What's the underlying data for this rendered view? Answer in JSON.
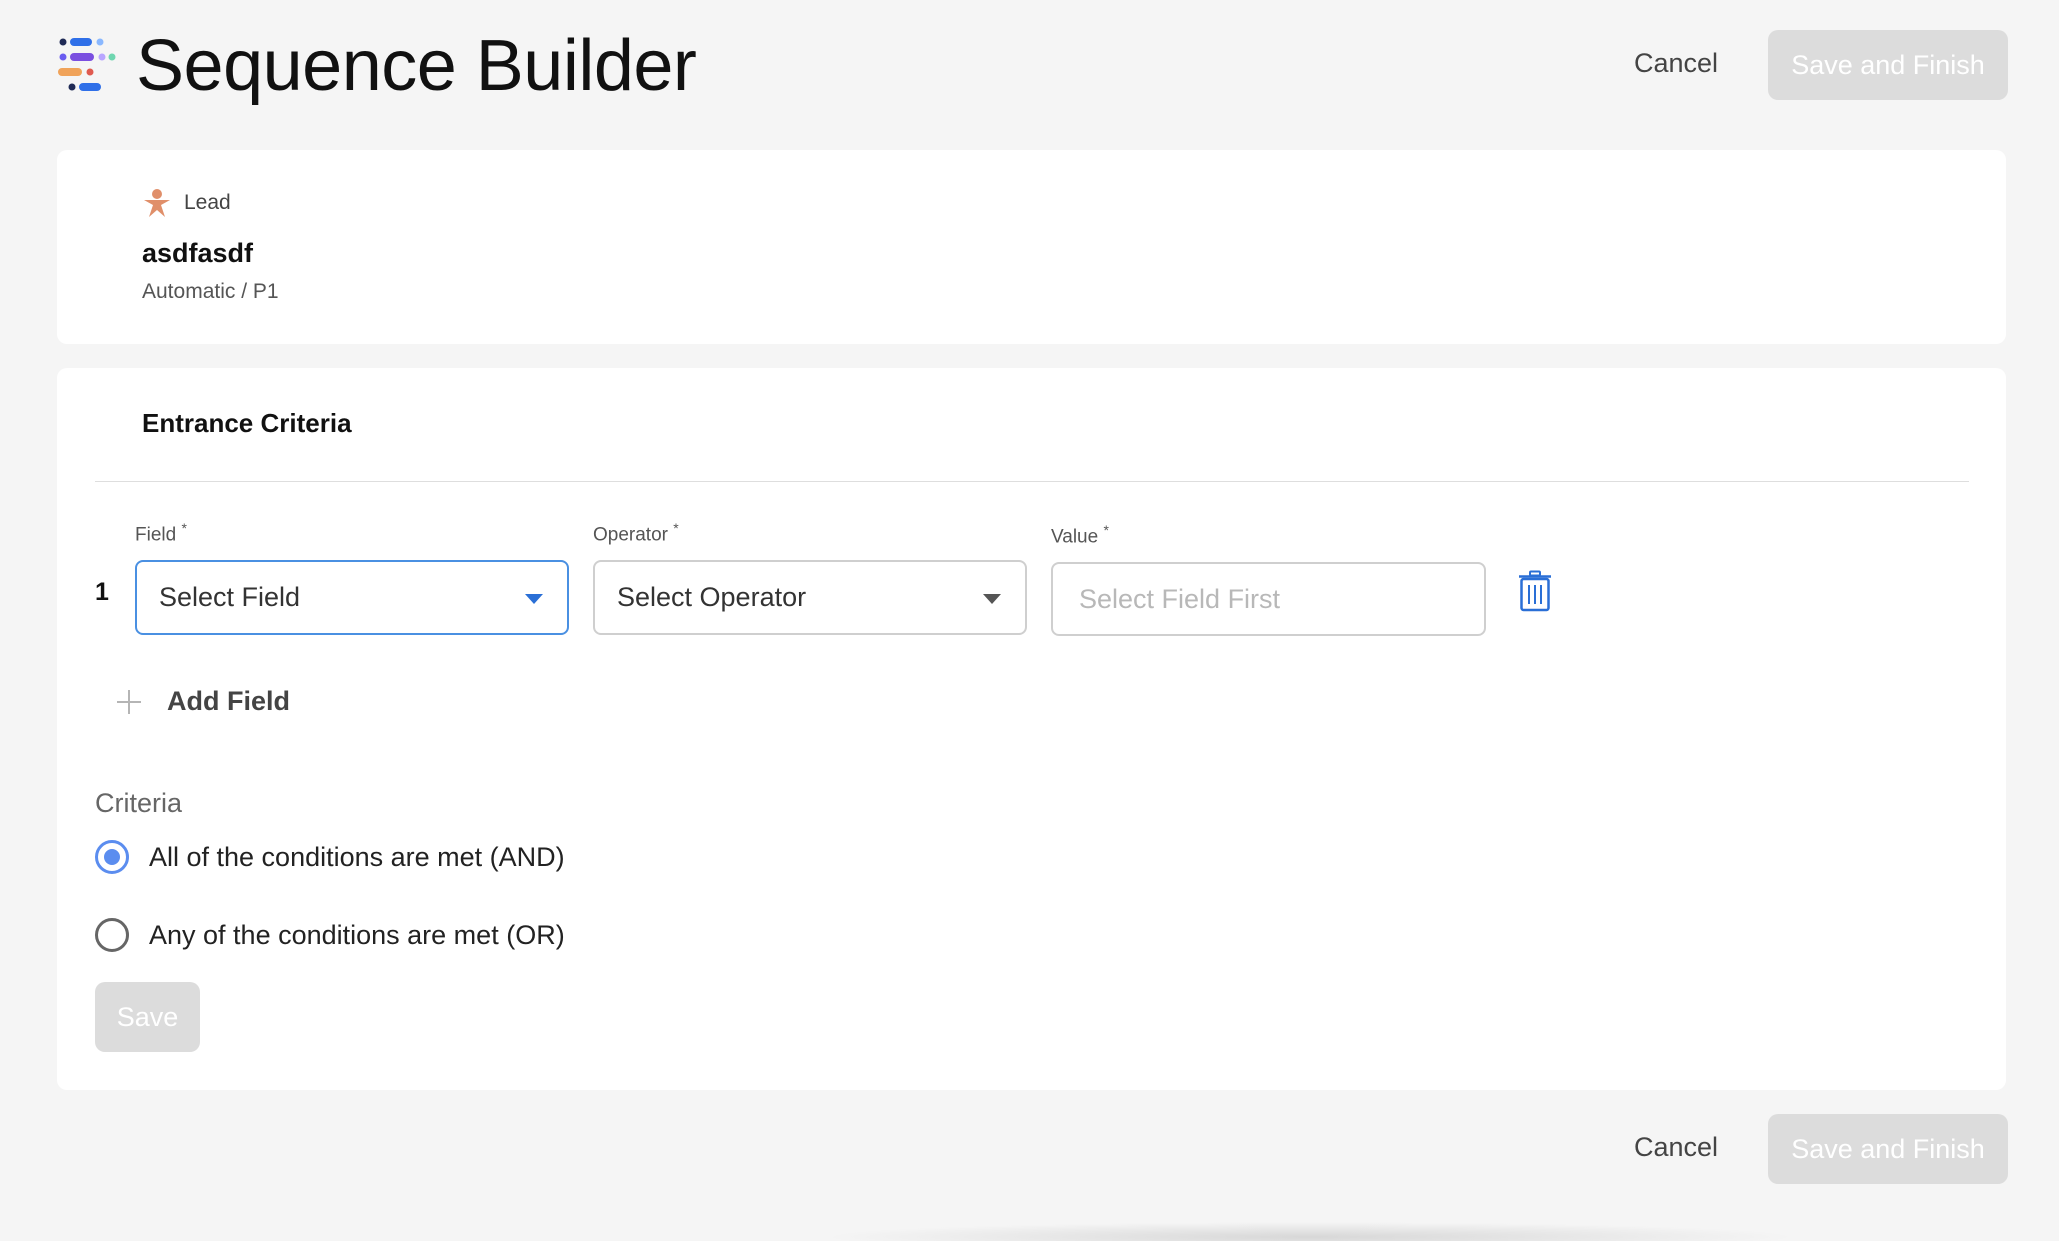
{
  "header": {
    "title": "Sequence Builder",
    "cancel_label": "Cancel",
    "save_finish_label": "Save and Finish"
  },
  "lead": {
    "tag": "Lead",
    "name": "asdfasdf",
    "sub": "Automatic / P1"
  },
  "criteria": {
    "section_title": "Entrance Criteria",
    "labels": {
      "field": "Field",
      "operator": "Operator",
      "value": "Value",
      "required_mark": "*"
    },
    "rows": [
      {
        "number": "1",
        "field_value": "Select Field",
        "operator_value": "Select Operator",
        "value_placeholder": "Select Field First"
      }
    ],
    "add_field_label": "Add Field",
    "criteria_label": "Criteria",
    "options": [
      {
        "label": "All of the conditions are met (AND)",
        "checked": true
      },
      {
        "label": "Any of the conditions are met (OR)",
        "checked": false
      }
    ],
    "save_label": "Save"
  },
  "footer": {
    "cancel_label": "Cancel",
    "save_finish_label": "Save and Finish"
  },
  "colors": {
    "accent": "#4a90e2",
    "radio_checked": "#5b8def",
    "disabled_button": "#dcdcdc",
    "trash_icon": "#2a6fd6",
    "lead_icon": "#e08f6a"
  },
  "icons": {
    "logo": "sequence-logo-icon",
    "lead": "person-icon",
    "trash": "trash-icon",
    "add": "plus-icon",
    "dropdown": "caret-down-icon"
  }
}
